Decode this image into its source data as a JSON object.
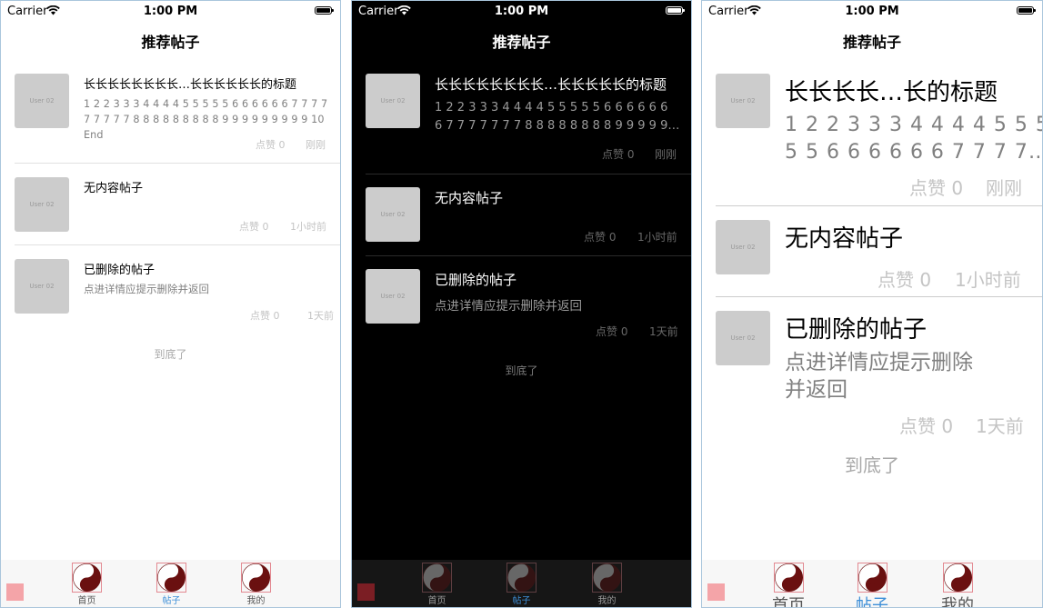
{
  "status": {
    "carrier": "Carrier",
    "time": "1:00 PM"
  },
  "nav": {
    "title": "推荐帖子"
  },
  "thumb_label": "User 02",
  "posts": [
    {
      "title": "长长长长长长长长…长长长长长长的标题",
      "content": "1 2 2 3 3 3 4 4 4 4 5 5 5 5 5 6 6 6 6 6 6 7 7 7 7 7 7 7 7 7 8 8 8 8 8 8 8 8 8 9 9 9 9 9 9 9 9 9 10 End",
      "likes": "点赞 0",
      "time": "刚刚"
    },
    {
      "title": "无内容帖子",
      "content": "",
      "likes": "点赞 0",
      "time": "1小时前"
    },
    {
      "title": "已删除的帖子",
      "content": "点进详情应提示删除并返回",
      "likes": "点赞 0",
      "time": "1天前"
    }
  ],
  "dark": {
    "post1_title": "长长长长长长长长…长长长长长的标题",
    "post1_content_line1": "1 2 2 3 3 3 4 4 4 4 5 5 5 5 5 6 6 6 6 6 6",
    "post1_content_line2": "6 7 7 7 7 7 7 7 8 8 8 8 8 8 8 8 9 9 9 9 9…"
  },
  "large": {
    "post1_title": "长长长长…长的标题",
    "post1_content_line1": "1 2 2 3 3 3 4 4 4 4 5 5 5",
    "post1_content_line2": "5 5 6 6 6 6 6 6 7 7 7 7…",
    "post3_content_line1": "点进详情应提示删除",
    "post3_content_line2": "并返回"
  },
  "footer": {
    "end_text": "到底了"
  },
  "tabs": [
    {
      "label": "首页",
      "active": false
    },
    {
      "label": "帖子",
      "active": true
    },
    {
      "label": "我的",
      "active": false
    }
  ],
  "colors": {
    "accent": "#3d8fd8",
    "thumb": "#cccccc",
    "tab_icon_border": "#e38a92",
    "dark_bg": "#000000"
  },
  "icons": {
    "tab_icon": "yin-yang-icon",
    "wifi": "wifi-icon",
    "battery": "battery-icon"
  }
}
